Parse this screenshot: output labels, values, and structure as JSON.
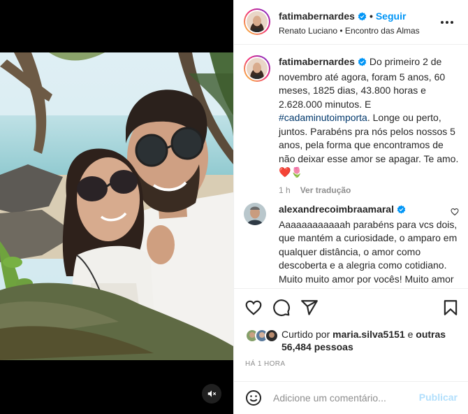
{
  "post": {
    "author": "fatimabernardes",
    "follow_label": "Seguir",
    "dot_separator": "•",
    "location_line": "Renato Luciano • Encontro das Almas",
    "verified_icon": "verified-badge-icon",
    "more_icon": "more-options-icon"
  },
  "caption": {
    "username": "fatimabernardes",
    "text_before": " Do primeiro 2 de novembro até agora, foram 5 anos, 60 meses, 1825 dias, 43.800 horas e 2.628.000 minutos. E ",
    "hashtag": "#cadaminutoimporta",
    "text_after": ". Longe ou perto, juntos. Parabéns pra nós pelos nossos 5 anos, pela forma que encontramos de não deixar esse amor se apagar. Te amo. ",
    "emojis": "❤️🌷",
    "time": "1 h",
    "translate_label": "Ver tradução"
  },
  "comments": [
    {
      "username": "alexandrecoimbraamaral",
      "text": " Aaaaaaaaaaaah parabéns para vcs dois, que mantém a curiosidade, o amparo em qualquer distância, o amor como descoberta e a alegria como cotidiano. Muito muito amor por vocês! Muito amor para vocês!"
    }
  ],
  "likes": {
    "prefix": "Curtido por ",
    "user": "maria.silva5151",
    "middle": " e ",
    "others": "outras 56,484 pessoas"
  },
  "time_ago": "HÁ 1 HORA",
  "add_comment": {
    "placeholder": "Adicione um comentário...",
    "publish_label": "Publicar"
  },
  "icons": {
    "like": "heart-outline-icon",
    "comment": "comment-bubble-icon",
    "share": "paper-plane-icon",
    "save": "bookmark-icon",
    "emoji": "emoji-smile-icon",
    "mute": "speaker-muted-icon"
  },
  "colors": {
    "accent_blue": "#0095f6",
    "hashtag_blue": "#00376b",
    "muted_text": "#8e8e8e",
    "publish_disabled": "#b2dffc",
    "heart_red": "#ed4956"
  }
}
